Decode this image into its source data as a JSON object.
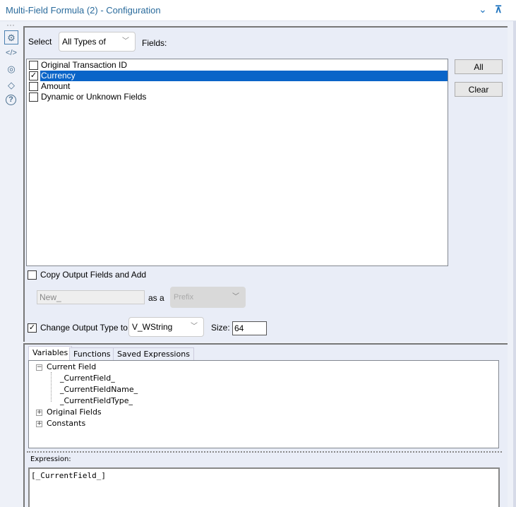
{
  "window": {
    "title": "Multi-Field Formula (2) - Configuration",
    "collapse_icon": "chevron-down-icon",
    "pin_icon": "pin-icon"
  },
  "sidebar": {
    "items": [
      {
        "icon": "gear-icon",
        "glyph": "⚙"
      },
      {
        "icon": "code-icon",
        "glyph": "</>"
      },
      {
        "icon": "annotation-icon",
        "glyph": "◎"
      },
      {
        "icon": "tag-icon",
        "glyph": "◇"
      },
      {
        "icon": "help-icon",
        "glyph": "?"
      }
    ]
  },
  "select": {
    "label": "Select",
    "type_value": "All Types of",
    "fields_label": "Fields:"
  },
  "fields": [
    {
      "name": "Original Transaction ID",
      "checked": false
    },
    {
      "name": "Currency",
      "checked": true,
      "selected": true
    },
    {
      "name": "Amount",
      "checked": false
    },
    {
      "name": "Dynamic or Unknown Fields",
      "checked": false
    }
  ],
  "buttons": {
    "all": "All",
    "clear": "Clear"
  },
  "copy": {
    "label": "Copy Output Fields and Add",
    "checked": false,
    "value": "New_",
    "as_a": "as a",
    "position": "Prefix"
  },
  "change_type": {
    "label": "Change Output Type to",
    "checked": true,
    "type": "V_WString",
    "size_label": "Size:",
    "size": "64"
  },
  "tabs": [
    "Variables",
    "Functions",
    "Saved Expressions"
  ],
  "tree": {
    "current_field": "Current Field",
    "children": [
      "_CurrentField_",
      "_CurrentFieldName_",
      "_CurrentFieldType_"
    ],
    "original_fields": "Original Fields",
    "constants": "Constants"
  },
  "expression": {
    "label": "Expression:",
    "value": "[_CurrentField_]"
  },
  "colors": {
    "selection": "#0a64c8",
    "title": "#2a6b9c",
    "accent": "#1e73be"
  }
}
